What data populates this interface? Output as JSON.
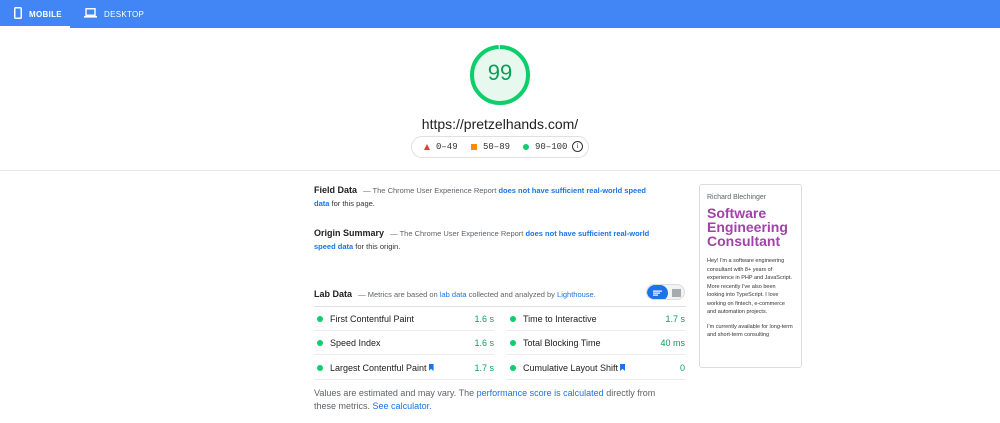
{
  "tabs": [
    {
      "label": "MOBILE",
      "active": true,
      "icon": "phone-icon"
    },
    {
      "label": "DESKTOP",
      "active": false,
      "icon": "laptop-icon"
    }
  ],
  "score": {
    "value": "99",
    "fraction": 0.99,
    "color": "#0cce6b"
  },
  "url": "https://pretzelhands.com/",
  "legend": {
    "fail": "0–49",
    "average": "50–89",
    "pass": "90–100"
  },
  "field_data": {
    "heading": "Field Data",
    "prefix": "— The Chrome User Experience Report",
    "link": "does not have sufficient real-world speed data",
    "suffix": "for this page."
  },
  "origin_summary": {
    "heading": "Origin Summary",
    "prefix": "— The Chrome User Experience Report",
    "link": "does not have sufficient real-world speed data",
    "suffix": "for this origin."
  },
  "lab_data": {
    "heading": "Lab Data",
    "prefix": "— Metrics are based on",
    "link1": "lab data",
    "middle": "collected and analyzed by",
    "link2": "Lighthouse",
    "end": "."
  },
  "metrics": [
    {
      "label": "First Contentful Paint",
      "value": "1.6 s"
    },
    {
      "label": "Time to Interactive",
      "value": "1.7 s"
    },
    {
      "label": "Speed Index",
      "value": "1.6 s"
    },
    {
      "label": "Total Blocking Time",
      "value": "40 ms"
    },
    {
      "label": "Largest Contentful Paint",
      "value": "1.7 s"
    },
    {
      "label": "Cumulative Layout Shift",
      "value": "0"
    }
  ],
  "footnote": {
    "text1": "Values are estimated and may vary. The",
    "link1": "performance score is calculated",
    "text2": "directly from these metrics.",
    "link2": "See calculator."
  },
  "ad": {
    "author": "Richard Blechinger",
    "title": "Software Engineering Consultant",
    "p1": "Hey! I'm a software engineering consultant with 8+ years of experience in PHP and JavaScript. More recently I've also been looking into TypeScript. I love working on fintech, e-commerce and automation projects.",
    "p2": "I'm currently available for long-term and short-term consulting"
  },
  "colors": {
    "brand": "#4285f4",
    "pass": "#0cce6b",
    "link": "#1a73e8",
    "ad_title": "#a142a8"
  }
}
